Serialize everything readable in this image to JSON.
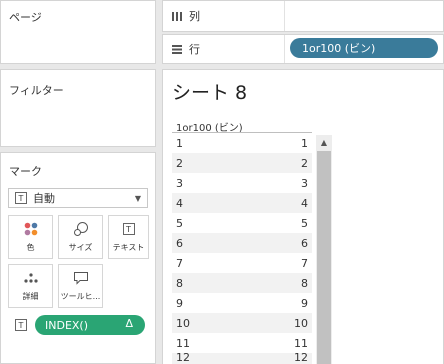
{
  "pages": {
    "label": "ページ"
  },
  "filters": {
    "label": "フィルター"
  },
  "marks": {
    "label": "マーク",
    "type_label": "自動",
    "buttons": [
      {
        "label": "色",
        "icon": "color-dots-icon"
      },
      {
        "label": "サイズ",
        "icon": "size-circles-icon"
      },
      {
        "label": "テキスト",
        "icon": "text-icon"
      },
      {
        "label": "詳細",
        "icon": "detail-dots-icon"
      },
      {
        "label": "ツールヒ...",
        "icon": "tooltip-icon"
      }
    ],
    "pill": {
      "label": "INDEX()",
      "suffix": "Δ"
    }
  },
  "columns_shelf": {
    "label": "列"
  },
  "rows_shelf": {
    "label": "行",
    "pill": "1or100 (ビン)"
  },
  "sheet": {
    "title": "シート 8",
    "header": "1or100 (ビン)",
    "rows": [
      [
        "1",
        "1"
      ],
      [
        "2",
        "2"
      ],
      [
        "3",
        "3"
      ],
      [
        "4",
        "4"
      ],
      [
        "5",
        "5"
      ],
      [
        "6",
        "6"
      ],
      [
        "7",
        "7"
      ],
      [
        "8",
        "8"
      ],
      [
        "9",
        "9"
      ],
      [
        "10",
        "10"
      ],
      [
        "11",
        "11"
      ],
      [
        "12",
        "12"
      ]
    ]
  }
}
